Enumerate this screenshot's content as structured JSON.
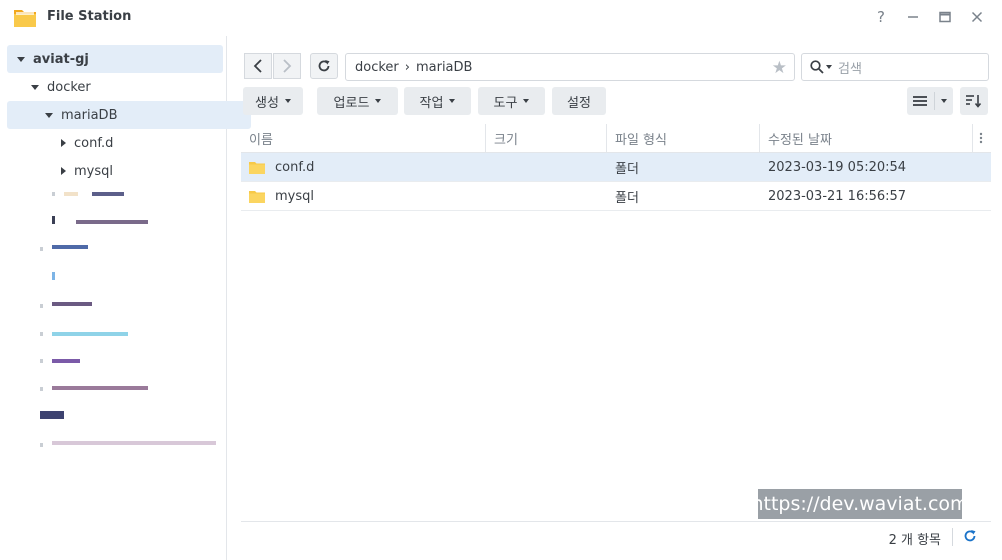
{
  "window": {
    "title": "File Station",
    "help": "?",
    "minimize": "—",
    "close": "✕"
  },
  "tree": {
    "root": "aviat-gj",
    "docker": "docker",
    "mariadb": "mariaDB",
    "confd": "conf.d",
    "mysql": "mysql"
  },
  "path": {
    "segment1": "docker",
    "separator": "›",
    "segment2": "mariaDB"
  },
  "search": {
    "placeholder": "검색"
  },
  "toolbar": {
    "create": "생성",
    "upload": "업로드",
    "action": "작업",
    "tools": "도구",
    "settings": "설정"
  },
  "columns": {
    "name": "이름",
    "size": "크기",
    "type": "파일 형식",
    "modified": "수정된 날짜"
  },
  "files": [
    {
      "name": "conf.d",
      "size": "",
      "type": "폴더",
      "modified": "2023-03-19 05:20:54"
    },
    {
      "name": "mysql",
      "size": "",
      "type": "폴더",
      "modified": "2023-03-21 16:56:57"
    }
  ],
  "footer": {
    "count": "2 개 항목"
  },
  "watermark": "https://dev.waviat.com",
  "colors": {
    "selection": "#e3edf8",
    "folder": "#f7c948",
    "accent": "#1a73c9"
  }
}
